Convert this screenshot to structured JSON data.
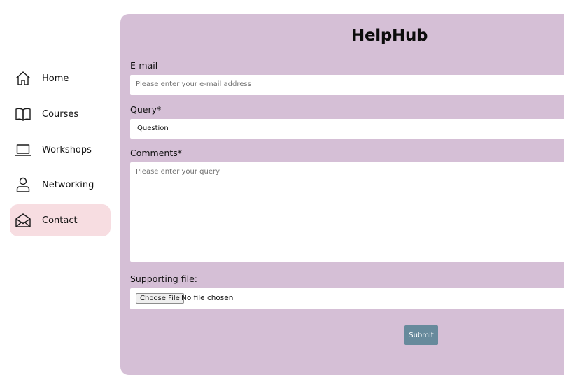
{
  "sidebar": {
    "items": [
      {
        "label": "Home",
        "icon": "home-icon",
        "active": false
      },
      {
        "label": "Courses",
        "icon": "book-icon",
        "active": false
      },
      {
        "label": "Workshops",
        "icon": "laptop-icon",
        "active": false
      },
      {
        "label": "Networking",
        "icon": "person-icon",
        "active": false
      },
      {
        "label": "Contact",
        "icon": "envelope-icon",
        "active": true
      }
    ]
  },
  "form": {
    "title": "HelpHub",
    "email": {
      "label": "E-mail",
      "placeholder": "Please enter your e-mail address"
    },
    "query": {
      "label": "Query*",
      "value": "Question"
    },
    "comments": {
      "label": "Comments*",
      "placeholder": "Please enter your query"
    },
    "file": {
      "label": "Supporting file:",
      "button_label": "Choose File",
      "status": "No file chosen"
    },
    "submit_label": "Submit"
  },
  "colors": {
    "panel_background": "#d5bfd6",
    "active_nav_background": "#f7dde1",
    "submit_background": "#678a9c",
    "page_background": "#ffffff"
  }
}
